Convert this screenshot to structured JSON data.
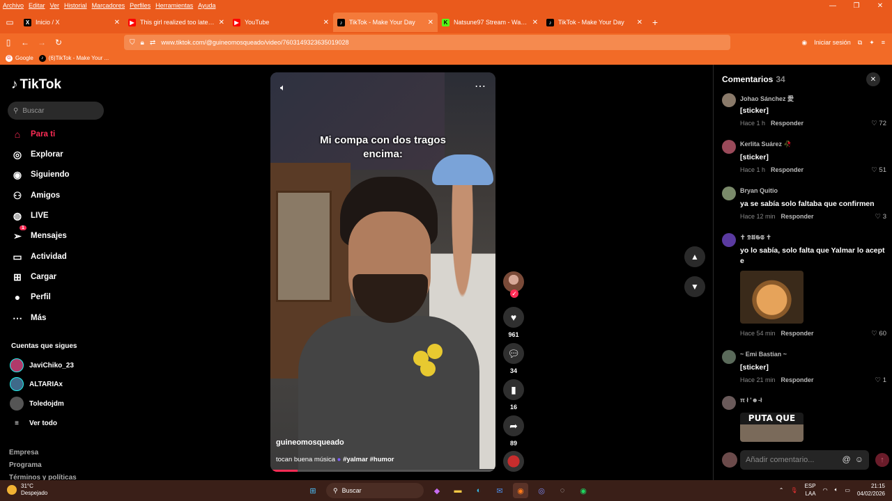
{
  "menubar": [
    "Archivo",
    "Editar",
    "Ver",
    "Historial",
    "Marcadores",
    "Perfiles",
    "Herramientas",
    "Ayuda"
  ],
  "tabs": [
    {
      "label": "Inicio / X",
      "favicon": "X",
      "color": "#000000",
      "active": false
    },
    {
      "label": "This girl realized too late that th",
      "favicon": "▶",
      "color": "#ff0000",
      "active": false
    },
    {
      "label": "YouTube",
      "favicon": "▶",
      "color": "#ff0000",
      "active": false
    },
    {
      "label": "TikTok - Make Your Day",
      "favicon": "♪",
      "color": "#000000",
      "active": true
    },
    {
      "label": "Natsune97 Stream - Watch Live",
      "favicon": "K",
      "color": "#53fc18",
      "active": false
    },
    {
      "label": "TikTok - Make Your Day",
      "favicon": "♪",
      "color": "#000000",
      "active": false
    }
  ],
  "url": "www.tiktok.com/@guineomosqueado/video/7603149323635019028",
  "signin_label": "Iniciar sesión",
  "bookmarks": [
    {
      "label": "Google"
    },
    {
      "label": "(6)TikTok - Make Your ..."
    }
  ],
  "tiktok": {
    "logo": "TikTok",
    "search_placeholder": "Buscar",
    "nav": [
      {
        "label": "Para ti",
        "icon": "home-icon",
        "active": true
      },
      {
        "label": "Explorar",
        "icon": "compass-icon",
        "active": false
      },
      {
        "label": "Siguiendo",
        "icon": "following-icon",
        "active": false
      },
      {
        "label": "Amigos",
        "icon": "friends-icon",
        "active": false
      },
      {
        "label": "LIVE",
        "icon": "live-icon",
        "active": false
      },
      {
        "label": "Mensajes",
        "icon": "messages-icon",
        "active": false,
        "badge": "1"
      },
      {
        "label": "Actividad",
        "icon": "activity-icon",
        "active": false
      },
      {
        "label": "Cargar",
        "icon": "upload-icon",
        "active": false
      },
      {
        "label": "Perfil",
        "icon": "profile-icon",
        "active": false
      },
      {
        "label": "Más",
        "icon": "more-icon",
        "active": false
      }
    ],
    "following_title": "Cuentas que sigues",
    "following": [
      {
        "name": "JaviChiko_23",
        "color": "#b03a6a"
      },
      {
        "name": "ALTARIAx",
        "color": "#3f6a8a"
      },
      {
        "name": "Toledojdm",
        "color": "#555555"
      }
    ],
    "see_all": "Ver todo",
    "footer": [
      "Empresa",
      "Programa",
      "Términos y políticas"
    ]
  },
  "video": {
    "caption_line1": "Mi compa con dos tragos",
    "caption_line2": "encima:",
    "username": "guineomosqueado",
    "description": "tocan buena música",
    "hashtags": "#yalmar #humor",
    "progress": 0.12,
    "likes": "961",
    "comments": "34",
    "saves": "16",
    "shares": "89"
  },
  "comments_panel": {
    "title": "Comentarios",
    "count": "34",
    "reply_label": "Responder",
    "input_placeholder": "Añadir comentario...",
    "items": [
      {
        "user": "Johao Sánchez 愛",
        "text": "[sticker]",
        "time": "Hace 1 h",
        "likes": "72",
        "avatar": "#8a7a6a"
      },
      {
        "user": "Kerlita Suárez 🥀",
        "text": "[sticker]",
        "time": "Hace 1 h",
        "likes": "51",
        "avatar": "#9a4a5a"
      },
      {
        "user": "Bryan Quitio",
        "text": "ya se sabía solo faltaba que confirmen",
        "time": "Hace 12 min",
        "likes": "3",
        "avatar": "#7a8a6a"
      },
      {
        "user": "✝ 𝕯𝖀𝕲𝕾 ✝",
        "text": "yo lo sabía, solo falta que Yalmar lo acept e",
        "time": "Hace 54 min",
        "likes": "60",
        "avatar": "#5a3aa0"
      },
      {
        "user": "~ Emi Bastian ~",
        "text": "[sticker]",
        "time": "Hace 21 min",
        "likes": "1",
        "avatar": "#5a6a5a"
      },
      {
        "user": "π ł '☻-ł",
        "text": "",
        "time": "",
        "likes": "",
        "avatar": "#6a5a5a",
        "image_text": "PUTA QUE"
      }
    ]
  },
  "taskbar": {
    "temp": "31°C",
    "weather": "Despejado",
    "search": "Buscar",
    "lang": "ESP",
    "lang2": "LAA",
    "time": "21:15",
    "date": "04/02/2026"
  }
}
